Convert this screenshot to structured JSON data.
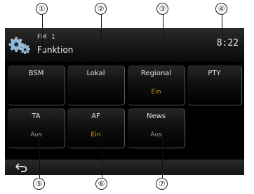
{
  "callouts": {
    "top": [
      "①",
      "②",
      "③",
      "④"
    ],
    "bottom": [
      "⑤",
      "⑥",
      "⑦"
    ]
  },
  "header": {
    "band": "FM",
    "preset": "1",
    "title": "Funktion",
    "clock": "8:22",
    "icon": "gear-icon"
  },
  "tiles": [
    {
      "label": "BSM",
      "status": ""
    },
    {
      "label": "Lokal",
      "status": ""
    },
    {
      "label": "Regional",
      "status": "Ein"
    },
    {
      "label": "PTY",
      "status": ""
    },
    {
      "label": "TA",
      "status": "Aus"
    },
    {
      "label": "AF",
      "status": "Ein"
    },
    {
      "label": "News",
      "status": "Aus"
    }
  ],
  "footer": {
    "back_icon": "back-arrow-icon"
  },
  "colors": {
    "status_on": "#d9a31f",
    "status_off": "#9a9a9a",
    "background": "#000000"
  }
}
